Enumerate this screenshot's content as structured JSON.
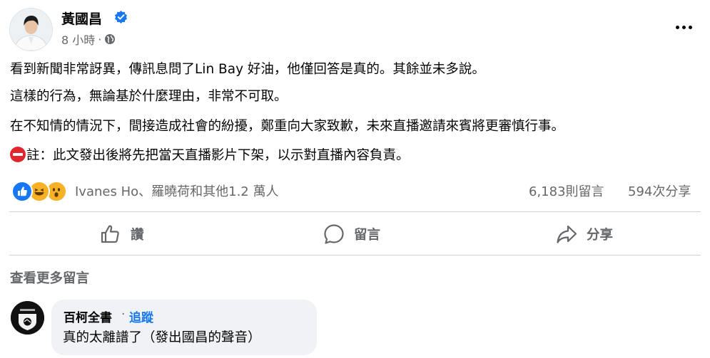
{
  "post": {
    "author": "黃國昌",
    "time": "8 小時",
    "time_sep": "·",
    "lines": [
      "看到新聞非常訝異，傳訊息問了Lin Bay 好油，他僅回答是真的。其餘並未多說。",
      "這樣的行為，無論基於什麼理由，非常不可取。",
      "在不知情的情況下，間接造成社會的紛擾，鄭重向大家致歉，未來直播邀請來賓將更審慎行事。"
    ],
    "note": "註：此文發出後將先把當天直播影片下架，以示對直播內容負責。"
  },
  "stats": {
    "reaction_names": "Ivanes Ho、羅曉荷和其他1.2 萬人",
    "comments": "6,183則留言",
    "shares": "594次分享"
  },
  "actions": {
    "like": "讚",
    "comment": "留言",
    "share": "分享"
  },
  "comments_section": {
    "view_more": "查看更多留言",
    "comment": {
      "name": "百柯全書",
      "dot": "·",
      "follow": "追蹤",
      "text": "真的太離譜了（發出國昌的聲音）"
    }
  },
  "colors": {
    "accent": "#1877f2",
    "secondary_text": "#65676b",
    "divider": "#ced0d4",
    "comment_bubble": "#f0f2f5"
  },
  "icons": [
    "verified-badge-icon",
    "globe-icon",
    "more-options-icon",
    "like-icon",
    "comment-icon",
    "share-icon",
    "no-entry-icon"
  ]
}
